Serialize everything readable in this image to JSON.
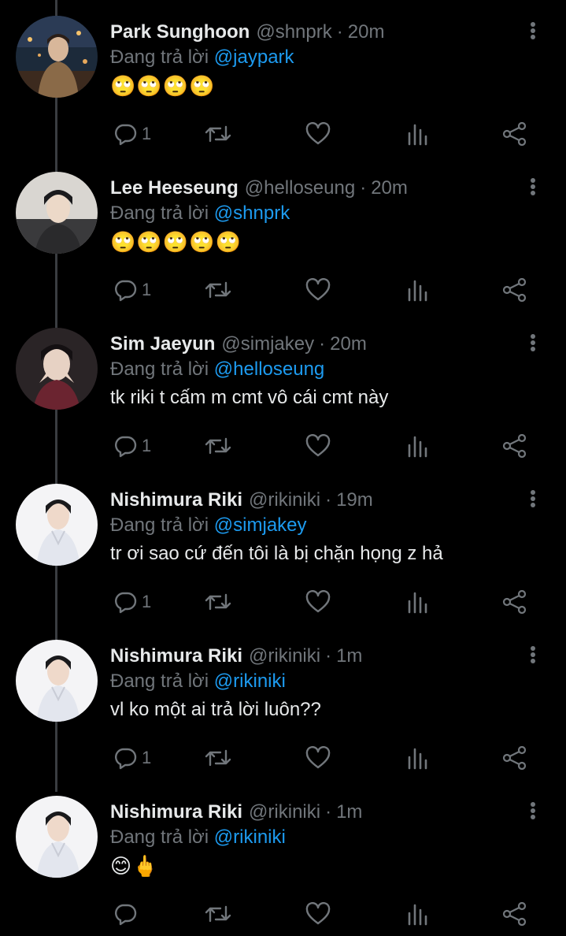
{
  "tweets": [
    {
      "name": "Park Sunghoon",
      "handle": "@shnprk",
      "separator": "·",
      "time": "20m",
      "reply_prefix": "Đang trả lời",
      "reply_to": "@jaypark",
      "content": "🙄🙄🙄🙄",
      "reply_count": "1"
    },
    {
      "name": "Lee Heeseung",
      "handle": "@helloseung",
      "separator": "·",
      "time": "20m",
      "reply_prefix": "Đang trả lời",
      "reply_to": "@shnprk",
      "content": "🙄🙄🙄🙄🙄",
      "reply_count": "1"
    },
    {
      "name": "Sim Jaeyun",
      "handle": "@simjakey",
      "separator": "·",
      "time": "20m",
      "reply_prefix": "Đang trả lời",
      "reply_to": "@helloseung",
      "content": "tk riki t cấm m cmt vô cái cmt này",
      "reply_count": "1"
    },
    {
      "name": "Nishimura Riki",
      "handle": "@rikiniki",
      "separator": "·",
      "time": "19m",
      "reply_prefix": "Đang trả lời",
      "reply_to": "@simjakey",
      "content": "tr ơi sao cứ đến tôi là bị chặn họng z hả",
      "reply_count": "1"
    },
    {
      "name": "Nishimura Riki",
      "handle": "@rikiniki",
      "separator": "·",
      "time": "1m",
      "reply_prefix": "Đang trả lời",
      "reply_to": "@rikiniki",
      "content": "vl ko một ai trả lời luôn??",
      "reply_count": "1"
    },
    {
      "name": "Nishimura Riki",
      "handle": "@rikiniki",
      "separator": "·",
      "time": "1m",
      "reply_prefix": "Đang trả lời",
      "reply_to": "@rikiniki",
      "content": "😊🖕",
      "reply_count": ""
    }
  ],
  "icons": {
    "reply": "reply-icon",
    "retweet": "retweet-icon",
    "like": "heart-icon",
    "stats": "stats-icon",
    "share": "share-icon",
    "menu": "more-options-icon"
  },
  "colors": {
    "background": "#000000",
    "text": "#e7e9ea",
    "muted": "#71767b",
    "mention": "#1d9bf0"
  }
}
